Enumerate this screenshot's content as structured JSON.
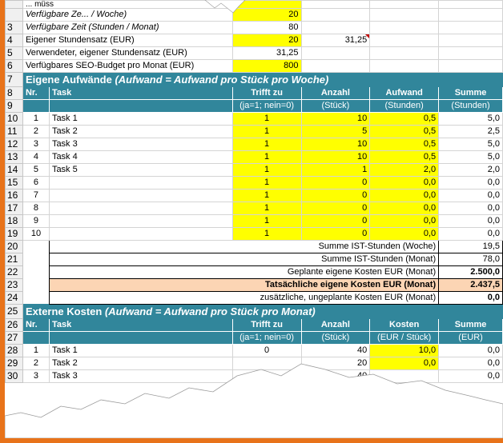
{
  "top": {
    "r1": {
      "label": "... müss"
    },
    "r2": {
      "label": "Verfügbare Ze... / Woche)",
      "value": "20"
    },
    "r3": {
      "label": "Verfügbare Zeit (Stunden / Monat)",
      "value": "80"
    },
    "r4": {
      "label": "Eigener Stundensatz (EUR)",
      "value": "20",
      "value2": "31,25"
    },
    "r5": {
      "label": "Verwendeter, eigener Stundensatz (EUR)",
      "value": "31,25"
    },
    "r6": {
      "label": "Verfügbares SEO-Budget pro Monat (EUR)",
      "value": "800"
    }
  },
  "section1": {
    "title": "Eigene Aufwände",
    "subtitle": "(Aufwand = Aufwand pro Stück pro Woche)",
    "headers": {
      "nr": "Nr.",
      "task": "Task",
      "trifft": "Trifft zu",
      "trifft_sub": "(ja=1; nein=0)",
      "anzahl": "Anzahl",
      "anzahl_sub": "(Stück)",
      "aufwand": "Aufwand",
      "aufwand_sub": "(Stunden)",
      "summe": "Summe",
      "summe_sub": "(Stunden)"
    },
    "rows": [
      {
        "nr": "1",
        "task": "Task 1",
        "trifft": "1",
        "anzahl": "10",
        "aufwand": "0,5",
        "summe": "5,0"
      },
      {
        "nr": "2",
        "task": "Task 2",
        "trifft": "1",
        "anzahl": "5",
        "aufwand": "0,5",
        "summe": "2,5"
      },
      {
        "nr": "3",
        "task": "Task 3",
        "trifft": "1",
        "anzahl": "10",
        "aufwand": "0,5",
        "summe": "5,0"
      },
      {
        "nr": "4",
        "task": "Task 4",
        "trifft": "1",
        "anzahl": "10",
        "aufwand": "0,5",
        "summe": "5,0"
      },
      {
        "nr": "5",
        "task": "Task 5",
        "trifft": "1",
        "anzahl": "1",
        "aufwand": "2,0",
        "summe": "2,0"
      },
      {
        "nr": "6",
        "task": "",
        "trifft": "1",
        "anzahl": "0",
        "aufwand": "0,0",
        "summe": "0,0"
      },
      {
        "nr": "7",
        "task": "",
        "trifft": "1",
        "anzahl": "0",
        "aufwand": "0,0",
        "summe": "0,0"
      },
      {
        "nr": "8",
        "task": "",
        "trifft": "1",
        "anzahl": "0",
        "aufwand": "0,0",
        "summe": "0,0"
      },
      {
        "nr": "9",
        "task": "",
        "trifft": "1",
        "anzahl": "0",
        "aufwand": "0,0",
        "summe": "0,0"
      },
      {
        "nr": "10",
        "task": "",
        "trifft": "1",
        "anzahl": "0",
        "aufwand": "0,0",
        "summe": "0,0"
      }
    ],
    "totals": [
      {
        "label": "Summe IST-Stunden (Woche)",
        "value": "19,5"
      },
      {
        "label": "Summe IST-Stunden (Monat)",
        "value": "78,0"
      },
      {
        "label": "Geplante eigene Kosten EUR (Monat)",
        "value": "2.500,0"
      },
      {
        "label": "Tatsächliche eigene Kosten EUR (Monat)",
        "value": "2.437,5"
      },
      {
        "label": "zusätzliche, ungeplante Kosten EUR (Monat)",
        "value": "0,0"
      }
    ]
  },
  "section2": {
    "title": "Externe Kosten",
    "subtitle": "(Aufwand = Aufwand pro Stück pro Monat)",
    "headers": {
      "nr": "Nr.",
      "task": "Task",
      "trifft": "Trifft zu",
      "trifft_sub": "(ja=1; nein=0)",
      "anzahl": "Anzahl",
      "anzahl_sub": "(Stück)",
      "kosten": "Kosten",
      "kosten_sub": "(EUR / Stück)",
      "summe": "Summe",
      "summe_sub": "(EUR)"
    },
    "rows": [
      {
        "nr": "1",
        "task": "Task 1",
        "trifft": "0",
        "anzahl": "40",
        "kosten": "10,0",
        "summe": "0,0"
      },
      {
        "nr": "2",
        "task": "Task 2",
        "trifft": "",
        "anzahl": "20",
        "kosten": "0,0",
        "summe": "0,0"
      },
      {
        "nr": "3",
        "task": "Task 3",
        "trifft": "",
        "anzahl": "40",
        "kosten": "",
        "summe": "0,0"
      }
    ]
  },
  "row_numbers": [
    "",
    "3",
    "4",
    "5",
    "6",
    "7",
    "8",
    "9",
    "10",
    "11",
    "12",
    "13",
    "14",
    "15",
    "16",
    "17",
    "18",
    "19",
    "20",
    "21",
    "22",
    "23",
    "24",
    "25",
    "26",
    "27",
    "28",
    "29",
    "30"
  ],
  "colors": {
    "header_teal": "#31869b",
    "highlight_yellow": "#ffff00",
    "highlight_peach": "#fcd5b4",
    "frame_orange": "#e8731a"
  }
}
